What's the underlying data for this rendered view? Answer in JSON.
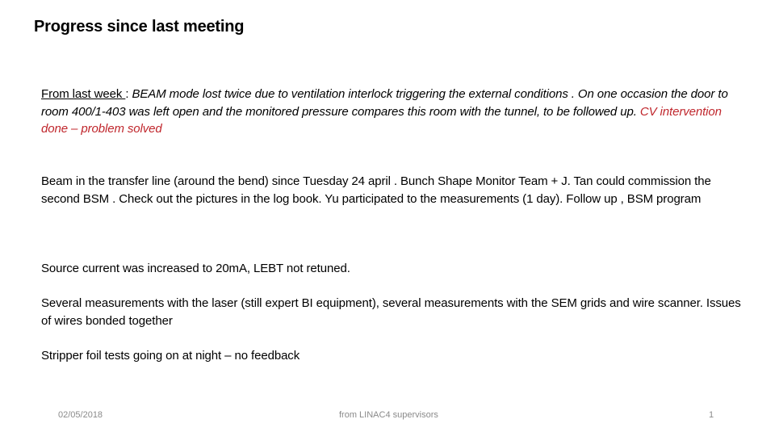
{
  "slide": {
    "title": "Progress since last meeting",
    "paragraphs": {
      "p1": {
        "lead": "From last week ",
        "colon": ": ",
        "italic": "BEAM mode lost twice due to ventilation interlock triggering the external conditions . On one occasion the door to room 400/1-403 was left open and the monitored pressure compares this room with the tunnel, to be followed up. ",
        "highlight": "CV intervention done – problem solved",
        "highlight_color": "#c0272d"
      },
      "p2": "Beam in the transfer line (around the bend) since Tuesday 24 april . Bunch Shape Monitor Team + J. Tan could commission the second  BSM . Check out the pictures in the log book. Yu participated to the measurements (1 day). Follow up , BSM program",
      "p3": "Source current was increased to 20mA, LEBT  not retuned.",
      "p4": "Several measurements with the laser (still expert BI equipment), several measurements with the SEM grids and wire scanner. Issues of wires bonded together",
      "p5": "Stripper foil tests going on at night – no feedback"
    },
    "footer": {
      "date": "02/05/2018",
      "center": "from LINAC4 supervisors",
      "page_number": "1"
    }
  }
}
